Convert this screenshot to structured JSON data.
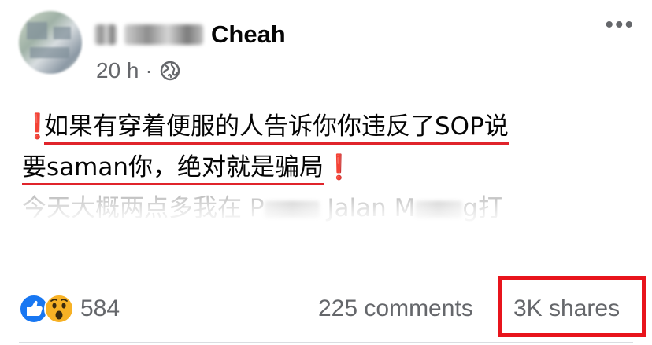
{
  "post": {
    "author_visible": "Cheah",
    "time": "20 h",
    "separator": "·",
    "visibility_icon": "globe-icon",
    "more_icon": "more-horizontal-icon",
    "text": {
      "excl": "❗",
      "line1": "如果有穿着便服的人告诉你你违反了SOP说",
      "line2": "要saman你，绝对就是骗局",
      "line3_a": "今天大概两点多我在 P",
      "line3_b": " Jalan M",
      "line3_c": "g打"
    }
  },
  "stats": {
    "reactions": [
      "like-icon",
      "wow-icon"
    ],
    "reaction_count": "584",
    "comments": "225 comments",
    "shares": "3K shares"
  },
  "colors": {
    "like_blue": "#1877f2",
    "wow_yellow": "#f7b125",
    "annotation_red": "#e8141c",
    "underline_red": "#e0242b",
    "meta_gray": "#65676b"
  }
}
